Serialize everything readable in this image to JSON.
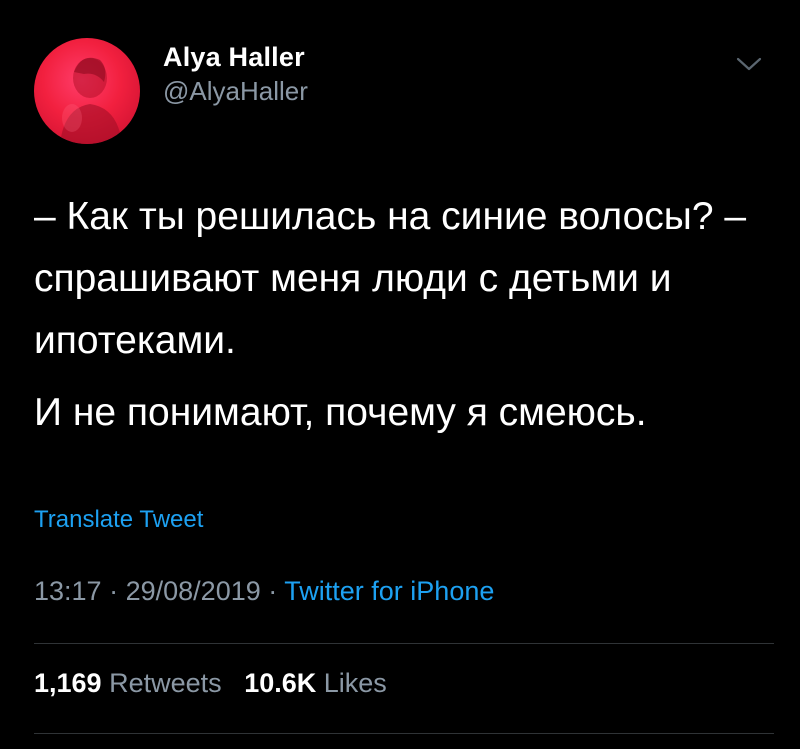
{
  "author": {
    "display_name": "Alya Haller",
    "handle": "@AlyaHaller",
    "avatar_color": "#f2203f"
  },
  "tweet": {
    "paragraphs": [
      "– Как ты решилась на синие волосы? – спрашивают меня люди с детьми и ипотеками.",
      "И не понимают, почему я смеюсь."
    ],
    "translate_label": "Translate Tweet"
  },
  "meta": {
    "time": "13:17",
    "separator": "·",
    "date": "29/08/2019",
    "source": "Twitter for iPhone"
  },
  "stats": {
    "retweets_count": "1,169",
    "retweets_label": "Retweets",
    "likes_count": "10.6K",
    "likes_label": "Likes"
  },
  "colors": {
    "background": "#000000",
    "link": "#1da1f2",
    "secondary_text": "#8b98a5",
    "divider": "#2f3336"
  },
  "icons": {
    "menu": "chevron-down-icon"
  }
}
